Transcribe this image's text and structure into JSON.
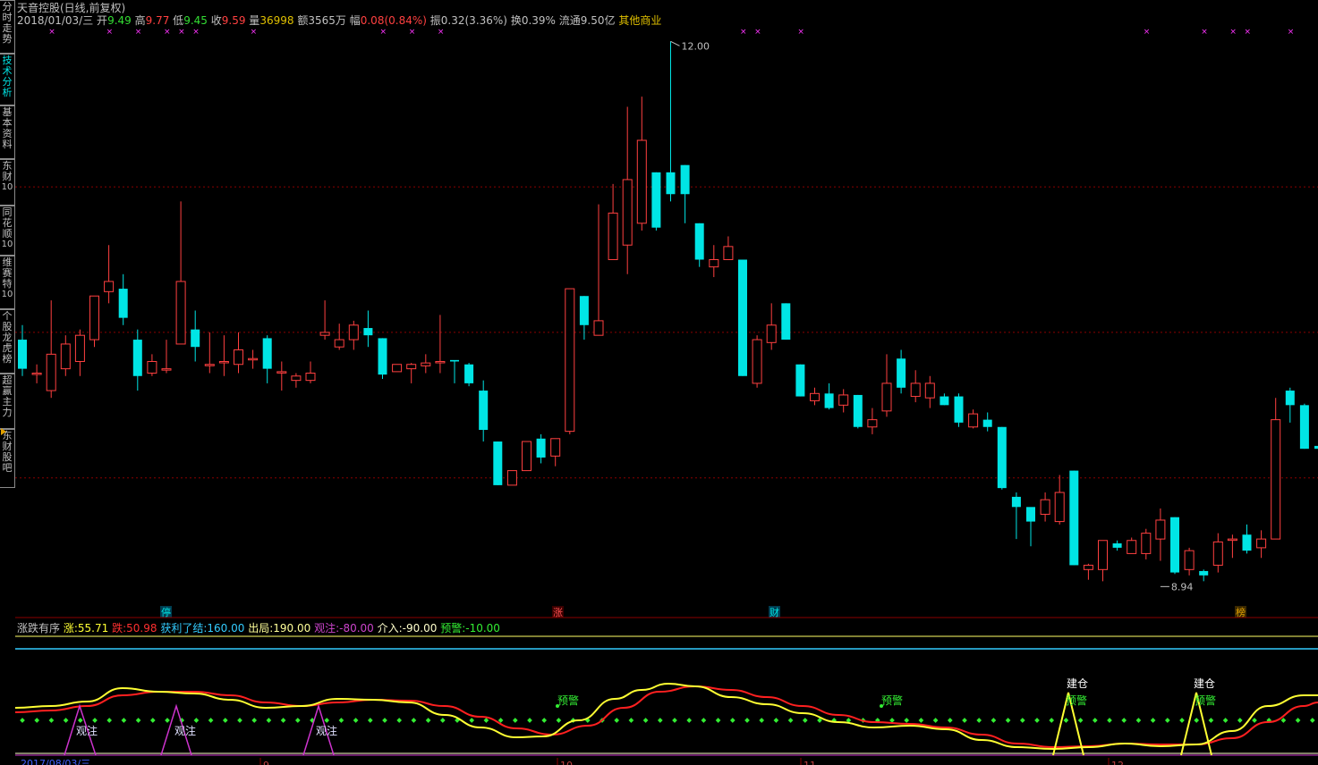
{
  "app": {
    "stock_title": "天音控股(日线,前复权)"
  },
  "sidebar": {
    "tabs": [
      {
        "label": "分时走势",
        "active": false
      },
      {
        "label": "技术分析",
        "active": true
      },
      {
        "label": "基本资料",
        "active": false
      },
      {
        "label": "东财",
        "num": "10",
        "active": false
      },
      {
        "label": "同花顺",
        "num": "10",
        "active": false
      },
      {
        "label": "维赛特",
        "num": "10",
        "active": false
      },
      {
        "label": "个股龙虎榜",
        "active": false
      },
      {
        "label": "超赢主力",
        "active": false
      },
      {
        "label": "东财股吧",
        "active": false
      }
    ]
  },
  "quote": {
    "date": "2018/01/03/三",
    "open_label": "开",
    "open": "9.49",
    "high_label": "高",
    "high": "9.77",
    "low_label": "低",
    "low": "9.45",
    "close_label": "收",
    "close": "9.59",
    "vol_label": "量",
    "vol": "36998",
    "amount_label": "额",
    "amount": "3565万",
    "change_label": "幅",
    "change": "0.08(0.84%)",
    "amplitude_label": "振",
    "amplitude": "0.32(3.36%)",
    "turnover_label": "换",
    "turnover": "0.39%",
    "float_label": "流通",
    "float": "9.50亿",
    "sector": "其他商业"
  },
  "price_chart": {
    "high_marker": "12.00",
    "low_marker": "8.94",
    "price_range": [
      8.7,
      12.1
    ],
    "candles": [
      [
        9.95,
        9.75,
        10.05,
        9.7
      ],
      [
        9.72,
        9.72,
        9.78,
        9.65
      ],
      [
        9.6,
        9.85,
        10.22,
        9.55
      ],
      [
        9.75,
        9.92,
        9.98,
        9.7
      ],
      [
        9.8,
        9.98,
        10.02,
        9.7
      ],
      [
        9.95,
        10.25,
        10.25,
        9.9
      ],
      [
        10.28,
        10.35,
        10.6,
        10.2
      ],
      [
        10.3,
        10.1,
        10.4,
        10.05
      ],
      [
        9.95,
        9.7,
        10.02,
        9.6
      ],
      [
        9.72,
        9.8,
        9.85,
        9.7
      ],
      [
        9.75,
        9.75,
        9.95,
        9.72
      ],
      [
        9.92,
        10.35,
        10.9,
        9.92
      ],
      [
        10.02,
        9.9,
        10.15,
        9.8
      ],
      [
        9.78,
        9.78,
        10.0,
        9.72
      ],
      [
        9.8,
        9.8,
        9.98,
        9.7
      ],
      [
        9.78,
        9.88,
        10.0,
        9.72
      ],
      [
        9.82,
        9.82,
        9.88,
        9.75
      ],
      [
        9.96,
        9.75,
        9.98,
        9.65
      ],
      [
        9.73,
        9.73,
        9.8,
        9.6
      ],
      [
        9.67,
        9.7,
        9.72,
        9.62
      ],
      [
        9.67,
        9.72,
        9.8,
        9.65
      ],
      [
        9.98,
        10.0,
        10.22,
        9.95
      ],
      [
        9.9,
        9.95,
        10.06,
        9.88
      ],
      [
        9.95,
        10.05,
        10.08,
        9.88
      ],
      [
        10.03,
        9.98,
        10.15,
        9.9
      ],
      [
        9.96,
        9.71,
        9.96,
        9.68
      ],
      [
        9.73,
        9.78,
        9.78,
        9.74
      ],
      [
        9.75,
        9.78,
        9.79,
        9.65
      ],
      [
        9.77,
        9.79,
        9.85,
        9.72
      ],
      [
        9.8,
        9.8,
        10.12,
        9.72
      ],
      [
        9.81,
        9.8,
        9.8,
        9.65
      ],
      [
        9.78,
        9.65,
        9.79,
        9.63
      ],
      [
        9.6,
        9.33,
        9.67,
        9.25
      ],
      [
        9.25,
        8.95,
        9.25,
        8.95
      ],
      [
        8.95,
        9.05,
        9.05,
        8.95
      ],
      [
        9.05,
        9.25,
        9.25,
        9.05
      ],
      [
        9.27,
        9.14,
        9.3,
        9.1
      ],
      [
        9.15,
        9.27,
        9.27,
        9.08
      ],
      [
        9.32,
        10.3,
        10.3,
        9.3
      ],
      [
        10.25,
        10.05,
        10.25,
        9.95
      ],
      [
        9.98,
        10.08,
        10.88,
        10.05
      ],
      [
        10.5,
        10.82,
        11.02,
        10.52
      ],
      [
        10.6,
        11.05,
        11.55,
        10.4
      ],
      [
        10.75,
        11.32,
        11.62,
        10.7
      ],
      [
        11.1,
        10.72,
        11.1,
        10.7
      ],
      [
        11.1,
        10.95,
        12.0,
        10.9
      ],
      [
        11.15,
        10.95,
        11.15,
        10.75
      ],
      [
        10.75,
        10.5,
        10.75,
        10.45
      ],
      [
        10.45,
        10.5,
        10.6,
        10.38
      ],
      [
        10.5,
        10.59,
        10.66,
        10.52
      ],
      [
        10.5,
        9.7,
        10.5,
        9.7
      ],
      [
        9.65,
        9.95,
        9.98,
        9.62
      ],
      [
        9.93,
        10.05,
        10.2,
        9.88
      ],
      [
        10.2,
        9.95,
        10.2,
        9.95
      ],
      [
        9.78,
        9.56,
        9.78,
        9.56
      ],
      [
        9.53,
        9.58,
        9.62,
        9.5
      ],
      [
        9.58,
        9.48,
        9.65,
        9.47
      ],
      [
        9.5,
        9.57,
        9.61,
        9.45
      ],
      [
        9.57,
        9.35,
        9.57,
        9.34
      ],
      [
        9.35,
        9.4,
        9.48,
        9.3
      ],
      [
        9.46,
        9.65,
        9.85,
        9.42
      ],
      [
        9.82,
        9.62,
        9.88,
        9.58
      ],
      [
        9.56,
        9.65,
        9.74,
        9.52
      ],
      [
        9.55,
        9.65,
        9.7,
        9.48
      ],
      [
        9.56,
        9.5,
        9.58,
        9.5
      ],
      [
        9.56,
        9.38,
        9.58,
        9.35
      ],
      [
        9.35,
        9.44,
        9.47,
        9.34
      ],
      [
        9.4,
        9.35,
        9.45,
        9.32
      ],
      [
        9.35,
        8.93,
        9.35,
        8.92
      ],
      [
        8.87,
        8.8,
        8.9,
        8.58
      ],
      [
        8.8,
        8.7,
        8.75,
        8.53
      ],
      [
        8.75,
        8.85,
        8.9,
        8.7
      ],
      [
        8.7,
        8.9,
        9.02,
        8.68
      ],
      [
        9.05,
        8.4,
        9.05,
        8.4
      ],
      [
        8.37,
        8.4,
        8.41,
        8.3
      ],
      [
        8.37,
        8.57,
        8.57,
        8.29
      ],
      [
        8.55,
        8.52,
        8.57,
        8.5
      ],
      [
        8.48,
        8.57,
        8.59,
        8.5
      ],
      [
        8.48,
        8.62,
        8.65,
        8.44
      ],
      [
        8.58,
        8.71,
        8.79,
        8.43
      ],
      [
        8.73,
        8.35,
        8.73,
        8.34
      ],
      [
        8.37,
        8.5,
        8.52,
        8.33
      ],
      [
        8.36,
        8.33,
        8.37,
        8.29
      ],
      [
        8.4,
        8.56,
        8.62,
        8.35
      ],
      [
        8.58,
        8.58,
        8.61,
        8.45
      ],
      [
        8.61,
        8.5,
        8.68,
        8.48
      ],
      [
        8.52,
        8.58,
        8.64,
        8.45
      ],
      [
        8.58,
        9.4,
        9.55,
        8.58
      ],
      [
        9.6,
        9.5,
        9.62,
        9.38
      ],
      [
        9.5,
        9.2,
        9.51,
        9.2
      ],
      [
        9.22,
        9.2,
        9.3,
        9.15
      ],
      [
        9.12,
        9.09,
        9.17,
        9.05
      ],
      [
        9.1,
        9.0,
        9.14,
        8.93
      ],
      [
        9.05,
        8.97,
        9.13,
        8.92
      ]
    ],
    "star_marks": [
      "×",
      "×",
      "×",
      "×",
      "×",
      "×",
      "×",
      "×",
      "×",
      "×",
      "×",
      "×",
      "×",
      "×",
      "×",
      "×",
      "×",
      "×"
    ],
    "bottom_tags": [
      {
        "text": "停",
        "color": "#00e5e5",
        "bg": "#003c50"
      },
      {
        "text": "涨",
        "color": "#ff5050",
        "bg": "#3a0000"
      },
      {
        "text": "财",
        "color": "#00e5e5",
        "bg": "#003c50"
      },
      {
        "text": "榜",
        "color": "#e0a000",
        "bg": "#3a2800"
      }
    ]
  },
  "indicator": {
    "name": "涨跌有序",
    "zhang_label": "涨:",
    "zhang": "55.71",
    "die_label": "跌:",
    "die": "50.98",
    "profit_label": "获利了结:",
    "profit": "160.00",
    "exit_label": "出局:",
    "exit": "190.00",
    "watch_label": "观注:",
    "watch": "-80.00",
    "enter_label": "介入:",
    "enter": "-90.00",
    "warn_label": "预警:",
    "warn": "-10.00",
    "watch_text": "观注",
    "warn_text": "预警",
    "build_text": "建仓"
  },
  "timeline": {
    "first_date": "2017/08/03/三",
    "labels": [
      "9",
      "10",
      "11",
      "12"
    ]
  },
  "colors": {
    "up": "#ff4040",
    "down": "#00e5e5",
    "grid": "#8b0000",
    "yellow": "#ffff33",
    "red_line": "#ff2020",
    "green_dot": "#33ee33",
    "magenta": "#cc33cc"
  }
}
